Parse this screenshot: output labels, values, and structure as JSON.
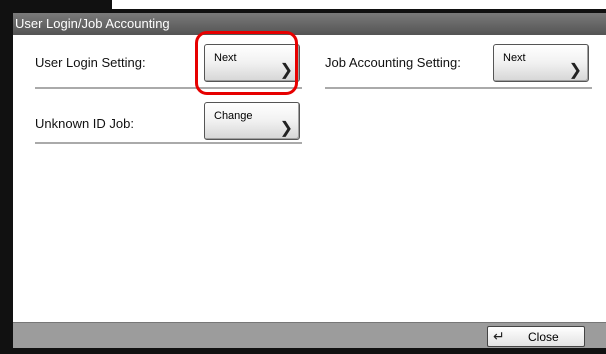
{
  "window": {
    "title": "User Login/Job Accounting"
  },
  "settings": {
    "user_login": {
      "label": "User Login Setting:",
      "button": "Next",
      "arrow": "❯"
    },
    "job_accounting": {
      "label": "Job Accounting Setting:",
      "button": "Next",
      "arrow": "❯"
    },
    "unknown_id_job": {
      "label": "Unknown ID Job:",
      "button": "Change",
      "arrow": "❯"
    }
  },
  "footer": {
    "close_label": "Close",
    "close_icon": "return-arrow-icon",
    "close_glyph": "↵"
  },
  "colors": {
    "highlight": "#e60000",
    "title_bar": "#666666",
    "status_bar": "#9c9c9c"
  }
}
